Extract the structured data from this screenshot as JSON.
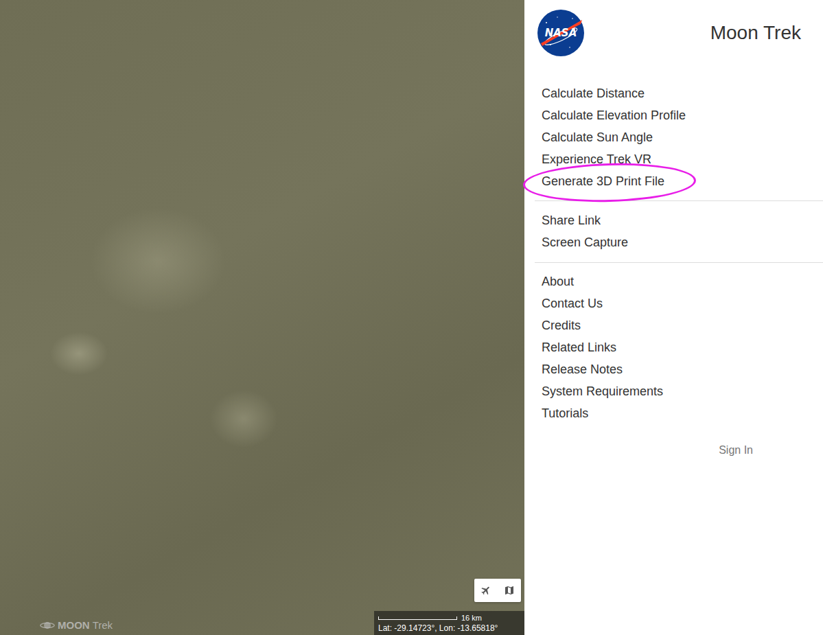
{
  "window": {
    "title": "Moon Trek"
  },
  "logo": {
    "text": "NASA"
  },
  "menu_groups": [
    {
      "items": [
        {
          "label": "Calculate Distance",
          "highlighted": false
        },
        {
          "label": "Calculate Elevation Profile",
          "highlighted": false
        },
        {
          "label": "Calculate Sun Angle",
          "highlighted": false
        },
        {
          "label": "Experience Trek VR",
          "highlighted": false
        },
        {
          "label": "Generate 3D Print File",
          "highlighted": true
        }
      ]
    },
    {
      "items": [
        {
          "label": "Share Link",
          "highlighted": false
        },
        {
          "label": "Screen Capture",
          "highlighted": false
        }
      ]
    },
    {
      "items": [
        {
          "label": "About",
          "highlighted": false
        },
        {
          "label": "Contact Us",
          "highlighted": false
        },
        {
          "label": "Credits",
          "highlighted": false
        },
        {
          "label": "Related Links",
          "highlighted": false
        },
        {
          "label": "Release Notes",
          "highlighted": false
        },
        {
          "label": "System Requirements",
          "highlighted": false
        },
        {
          "label": "Tutorials",
          "highlighted": false
        }
      ]
    }
  ],
  "sign_in": "Sign In",
  "map": {
    "attribution": {
      "strong": "MOON",
      "light": "Trek"
    },
    "scale": "16 km",
    "coordinates": "Lat: -29.14723°, Lon: -13.65818°"
  }
}
